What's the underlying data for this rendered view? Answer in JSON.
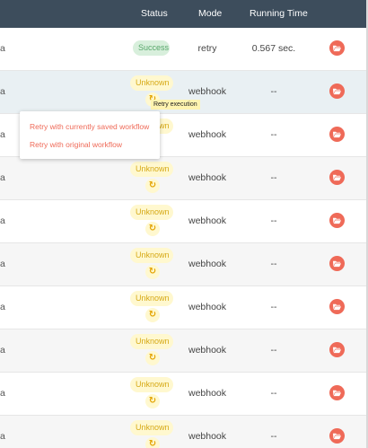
{
  "header": {
    "status": "Status",
    "mode": "Mode",
    "running_time": "Running Time"
  },
  "rows": [
    {
      "name_fragment": "a",
      "status": "Success",
      "mode": "retry",
      "running_time": "0.567 sec."
    },
    {
      "name_fragment": "a",
      "status": "Unknown",
      "mode": "webhook",
      "running_time": "--"
    },
    {
      "name_fragment": "a",
      "status": "Unknown",
      "mode": "webhook",
      "running_time": "--"
    },
    {
      "name_fragment": "a",
      "status": "Unknown",
      "mode": "webhook",
      "running_time": "--"
    },
    {
      "name_fragment": "a",
      "status": "Unknown",
      "mode": "webhook",
      "running_time": "--"
    },
    {
      "name_fragment": "a",
      "status": "Unknown",
      "mode": "webhook",
      "running_time": "--"
    },
    {
      "name_fragment": "a",
      "status": "Unknown",
      "mode": "webhook",
      "running_time": "--"
    },
    {
      "name_fragment": "a",
      "status": "Unknown",
      "mode": "webhook",
      "running_time": "--"
    },
    {
      "name_fragment": "a",
      "status": "Unknown",
      "mode": "webhook",
      "running_time": "--"
    },
    {
      "name_fragment": "a",
      "status": "Unknown",
      "mode": "webhook",
      "running_time": "--"
    }
  ],
  "tooltip": "Retry execution",
  "retry_menu": {
    "items": [
      "Retry with currently saved workflow",
      "Retry with original workflow"
    ]
  },
  "icons": {
    "retry": "refresh-icon",
    "open": "folder-open-icon"
  },
  "colors": {
    "header_bg": "#3d4d5c",
    "success_bg": "#d8efdc",
    "success_text": "#58a76b",
    "unknown_bg": "#fff8cf",
    "unknown_text": "#d6a916",
    "accent": "#ef6a58"
  }
}
